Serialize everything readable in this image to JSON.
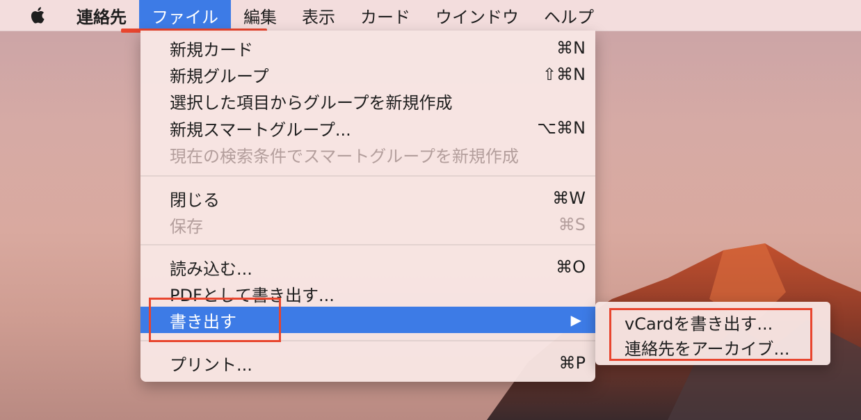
{
  "menubar": {
    "apple_icon": "apple-logo-icon",
    "items": [
      "連絡先",
      "ファイル",
      "編集",
      "表示",
      "カード",
      "ウインドウ",
      "ヘルプ"
    ]
  },
  "file_menu": {
    "new_card": {
      "label": "新規カード",
      "shortcut": "⌘N"
    },
    "new_group": {
      "label": "新規グループ",
      "shortcut": "⇧⌘N"
    },
    "new_group_from_selection": {
      "label": "選択した項目からグループを新規作成"
    },
    "new_smart_group": {
      "label": "新規スマートグループ...",
      "shortcut": "⌥⌘N"
    },
    "new_smart_group_from_search": {
      "label": "現在の検索条件でスマートグループを新規作成"
    },
    "close": {
      "label": "閉じる",
      "shortcut": "⌘W"
    },
    "save": {
      "label": "保存",
      "shortcut": "⌘S"
    },
    "import": {
      "label": "読み込む...",
      "shortcut": "⌘O"
    },
    "export_pdf": {
      "label": "PDFとして書き出す..."
    },
    "export": {
      "label": "書き出す",
      "submenu_icon": "triangle-right-icon"
    },
    "print": {
      "label": "プリント...",
      "shortcut": "⌘P"
    }
  },
  "export_submenu": {
    "export_vcard": "vCardを書き出す...",
    "archive_contacts": "連絡先をアーカイブ..."
  },
  "colors": {
    "accent": "#3d7be6",
    "annotation_red": "#e8452e"
  }
}
